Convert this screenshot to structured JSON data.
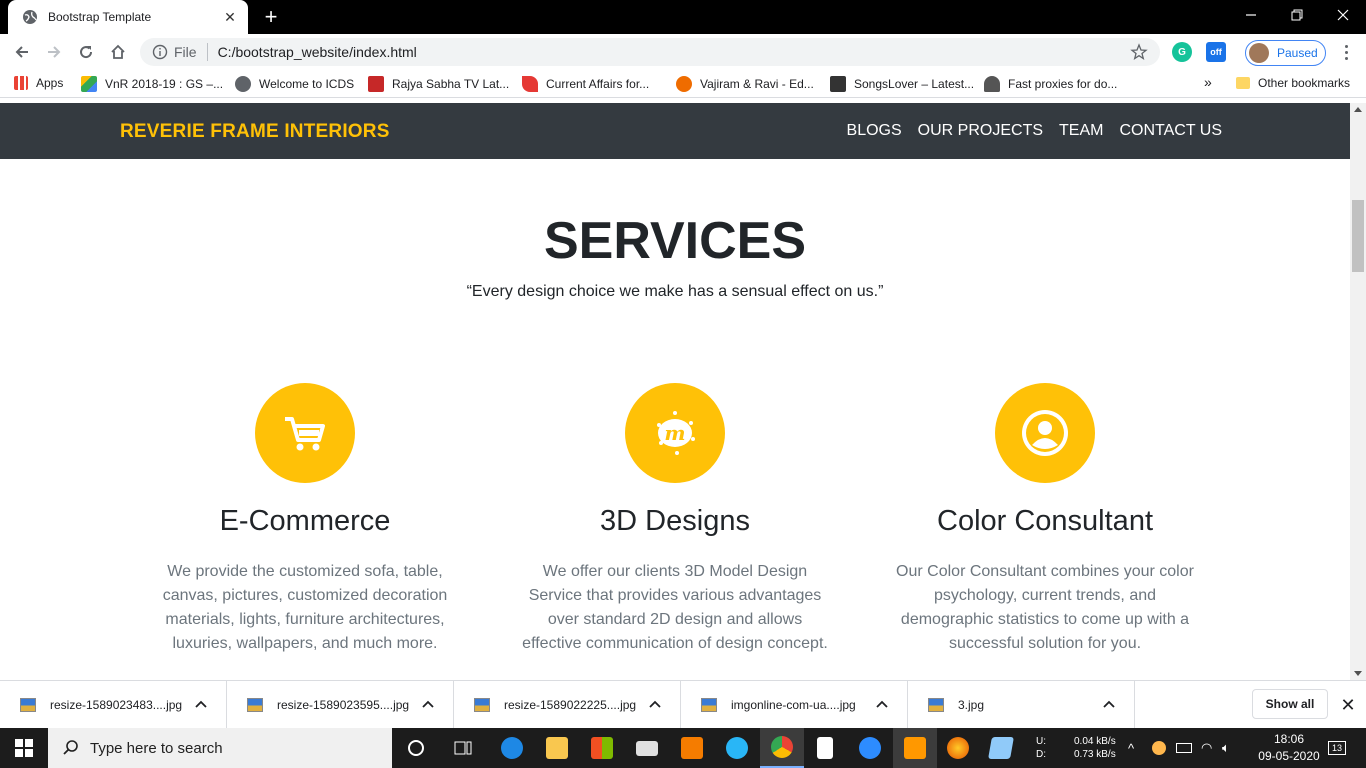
{
  "browser": {
    "tab_title": "Bootstrap Template",
    "omnibox": {
      "scheme_label": "File",
      "url": "C:/bootstrap_website/index.html"
    },
    "profile_status": "Paused",
    "bookmarks": [
      {
        "label": "Apps"
      },
      {
        "label": "VnR 2018-19 : GS –..."
      },
      {
        "label": "Welcome to ICDS"
      },
      {
        "label": "Rajya Sabha TV Lat..."
      },
      {
        "label": "Current Affairs for..."
      },
      {
        "label": "Vajiram & Ravi - Ed..."
      },
      {
        "label": "SongsLover – Latest..."
      },
      {
        "label": "Fast proxies for do..."
      }
    ],
    "bookmarks_overflow": "»",
    "other_bookmarks": "Other bookmarks"
  },
  "site": {
    "brand": "REVERIE FRAME INTERIORS",
    "nav": [
      "BLOGS",
      "OUR PROJECTS",
      "TEAM",
      "CONTACT US"
    ],
    "services": {
      "title": "SERVICES",
      "quote": "“Every design choice we make has a sensual effect on us.”",
      "cards": [
        {
          "icon": "shopping-cart-icon",
          "title": "E-Commerce",
          "text": "We provide the customized sofa, table, canvas, pictures, customized decoration materials, lights, furniture architectures, luxuries, wallpapers, and much more."
        },
        {
          "icon": "meetup-icon",
          "title": "3D Designs",
          "text": "We offer our clients 3D Model Design Service that provides various advantages over standard 2D design and allows effective communication of design concept."
        },
        {
          "icon": "user-circle-icon",
          "title": "Color Consultant",
          "text": "Our Color Consultant combines your color psychology, current trends, and demographic statistics to come up with a successful solution for you."
        }
      ]
    }
  },
  "downloads": {
    "items": [
      "resize-1589023483....jpg",
      "resize-1589023595....jpg",
      "resize-1589022225....jpg",
      "imgonline-com-ua....jpg",
      "3.jpg"
    ],
    "show_all": "Show all"
  },
  "taskbar": {
    "search_placeholder": "Type here to search",
    "net_labels": [
      "U:",
      "D:"
    ],
    "net_speeds": [
      "0.04 kB/s",
      "0.73 kB/s"
    ],
    "time": "18:06",
    "date": "09-05-2020",
    "notification_count": "13"
  },
  "colors": {
    "accent": "#ffc107",
    "navbar": "#343a40",
    "muted_text": "#6c757d"
  }
}
